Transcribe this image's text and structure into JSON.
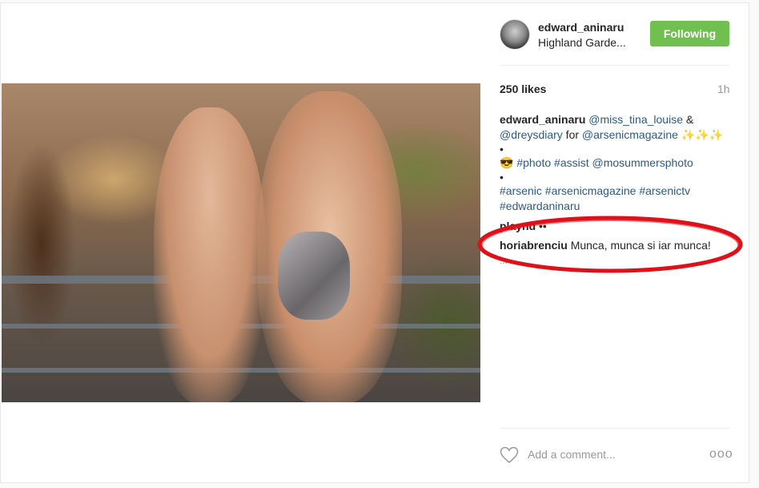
{
  "header": {
    "username": "edward_aninaru",
    "location": "Highland Garde...",
    "follow_label": "Following"
  },
  "meta": {
    "likes": "250 likes",
    "time": "1h"
  },
  "caption": {
    "username": "edward_aninaru",
    "line1_mention1": "@miss_tina_louise",
    "line1_amp": " &",
    "line2_mention": "@dreysdiary",
    "line2_for": " for ",
    "line2_mention2": "@arsenicmagazine",
    "line2_sparkles": " ✨✨✨",
    "dot": "•",
    "line3_emoji": "😎",
    "line3_tags": "#photo #assist",
    "line3_mention": "@mosummersphoto",
    "line4_tags": "#arsenic #arsenicmagazine #arsenictv",
    "line5_tags": "#edwardaninaru"
  },
  "comments": [
    {
      "username": "playnd",
      "text": "••"
    },
    {
      "username": "horiabrenciu",
      "text": "Munca, munca si iar munca!"
    }
  ],
  "more_label": "...",
  "add_comment": {
    "placeholder": "Add a comment..."
  },
  "options_label": "ooo",
  "colors": {
    "follow_button": "#70c050",
    "mention": "#2b5a8a",
    "highlight_oval": "#e0101a"
  }
}
